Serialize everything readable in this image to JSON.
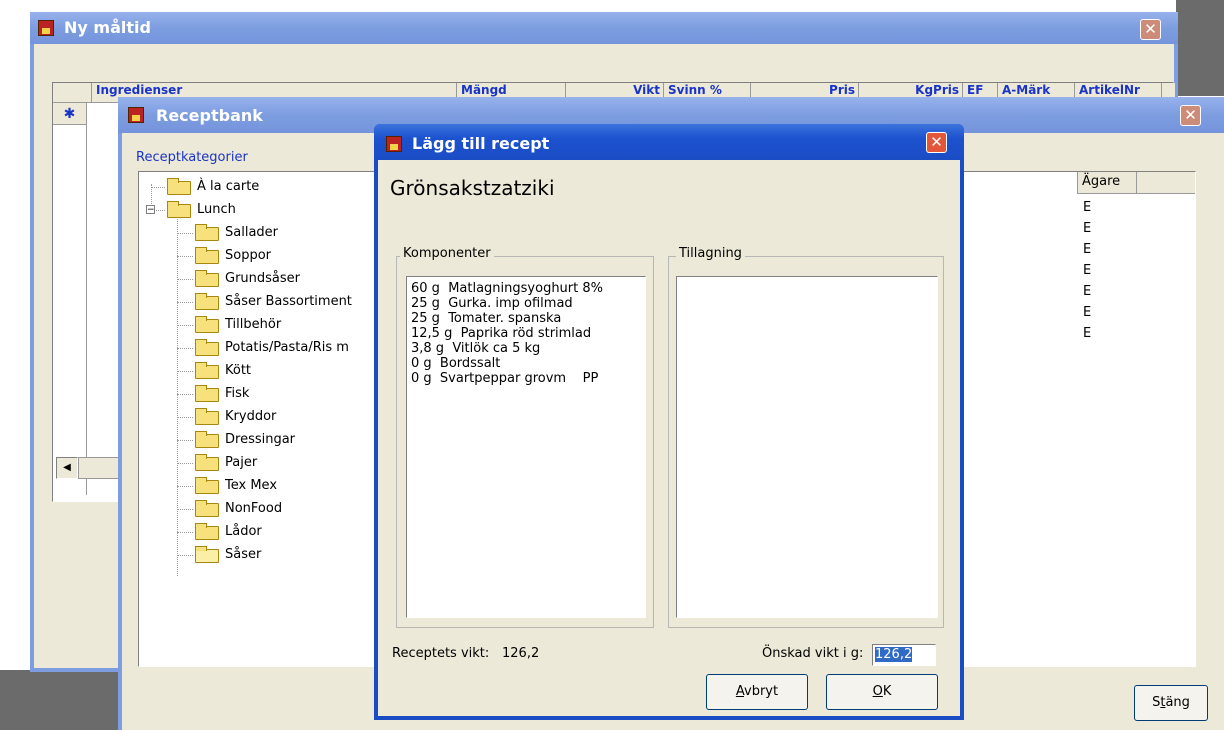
{
  "ny_maltid": {
    "title": "Ny måltid",
    "grid_columns": [
      "Ingredienser",
      "Mängd",
      "Vikt",
      "Svinn %",
      "Pris",
      "KgPris",
      "EF",
      "A-Märk",
      "ArtikelNr"
    ],
    "new_row_marker": "✱"
  },
  "receptbank": {
    "title": "Receptbank",
    "categories_label": "Receptkategorier",
    "tree": [
      {
        "label": "À la carte",
        "level": 0
      },
      {
        "label": "Lunch",
        "level": 0,
        "expanded": true
      },
      {
        "label": "Sallader",
        "level": 1
      },
      {
        "label": "Soppor",
        "level": 1
      },
      {
        "label": "Grundsåser",
        "level": 1
      },
      {
        "label": "Såser Bassortiment",
        "level": 1
      },
      {
        "label": "Tillbehör",
        "level": 1
      },
      {
        "label": "Potatis/Pasta/Ris m",
        "level": 1
      },
      {
        "label": "Kött",
        "level": 1
      },
      {
        "label": "Fisk",
        "level": 1
      },
      {
        "label": "Kryddor",
        "level": 1
      },
      {
        "label": "Dressingar",
        "level": 1
      },
      {
        "label": "Pajer",
        "level": 1
      },
      {
        "label": "Tex Mex",
        "level": 1
      },
      {
        "label": "NonFood",
        "level": 1
      },
      {
        "label": "Lådor",
        "level": 1
      },
      {
        "label": "Såser",
        "level": 1,
        "open": true
      }
    ],
    "owner_header": "Ägare",
    "owner_values": [
      "E",
      "E",
      "E",
      "E",
      "E",
      "E",
      "E"
    ],
    "close_label": "Stäng"
  },
  "dialog": {
    "title": "Lägg till recept",
    "recipe_name": "Grönsakstzatziki",
    "components_label": "Komponenter",
    "components": [
      "60 g  Matlagningsyoghurt 8%",
      "25 g  Gurka. imp ofilmad",
      "25 g  Tomater. spanska",
      "12,5 g  Paprika röd strimlad",
      "3,8 g  Vitlök ca 5 kg",
      "0 g  Bordssalt",
      "0 g  Svartpeppar grovm    PP"
    ],
    "preparation_label": "Tillagning",
    "weight_label": "Receptets vikt:",
    "weight_value": "126,2",
    "desired_weight_label": "Önskad vikt i g:",
    "desired_weight_value": "126,2",
    "cancel_label": "Avbryt",
    "ok_label": "OK"
  },
  "colors": {
    "title_active": "#1d52cf",
    "title_inactive": "#7d9de0",
    "close_button": "#e2573a",
    "link_blue": "#1a34c8",
    "selection": "#316ac5"
  }
}
